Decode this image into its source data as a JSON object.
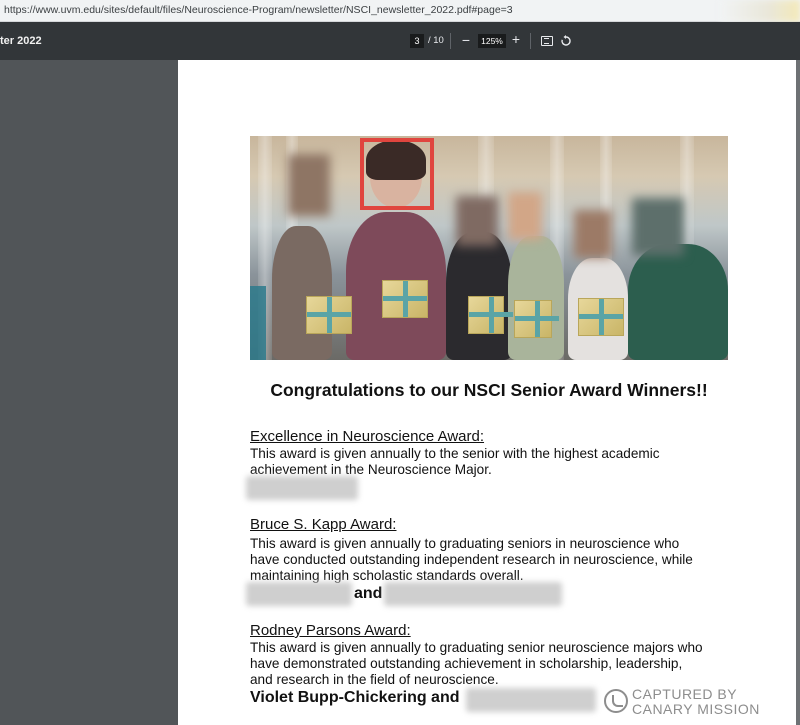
{
  "browser": {
    "url": "https://www.uvm.edu/sites/default/files/Neuroscience-Program/newsletter/NSCI_newsletter_2022.pdf#page=3"
  },
  "toolbar": {
    "doc_title": "ter 2022",
    "current_page": "3",
    "page_total": "/ 10",
    "zoom_out": "−",
    "zoom_level": "125%",
    "zoom_in": "+",
    "icons": [
      "fit-page-icon",
      "rotate-icon"
    ]
  },
  "document": {
    "headline": "Congratulations to our NSCI Senior Award Winners!!",
    "awards": [
      {
        "title": "Excellence in Neuroscience Award:",
        "description": [
          "This award is given annually to the senior with the highest academic",
          "achievement in the Neuroscience Major."
        ]
      },
      {
        "title": "Bruce S. Kapp Award:",
        "description": [
          "This award is given annually to graduating seniors in neuroscience who",
          "have conducted outstanding independent research in neuroscience, while",
          "maintaining high scholastic standards overall."
        ],
        "conjunction": "and"
      },
      {
        "title": "Rodney Parsons Award:",
        "description": [
          "This award is given annually to graduating senior neuroscience majors who",
          "have demonstrated outstanding achievement in scholarship, leadership,",
          "and research in the field of neuroscience."
        ],
        "winners_text": "Violet Bupp-Chickering and"
      }
    ]
  },
  "watermark": {
    "line1": "CAPTURED BY",
    "line2": "CANARY MISSION",
    "color": "#8d8d8d"
  },
  "colors": {
    "toolbar_bg": "#323639",
    "viewer_bg": "#525659",
    "highlight": "#e0453e"
  }
}
